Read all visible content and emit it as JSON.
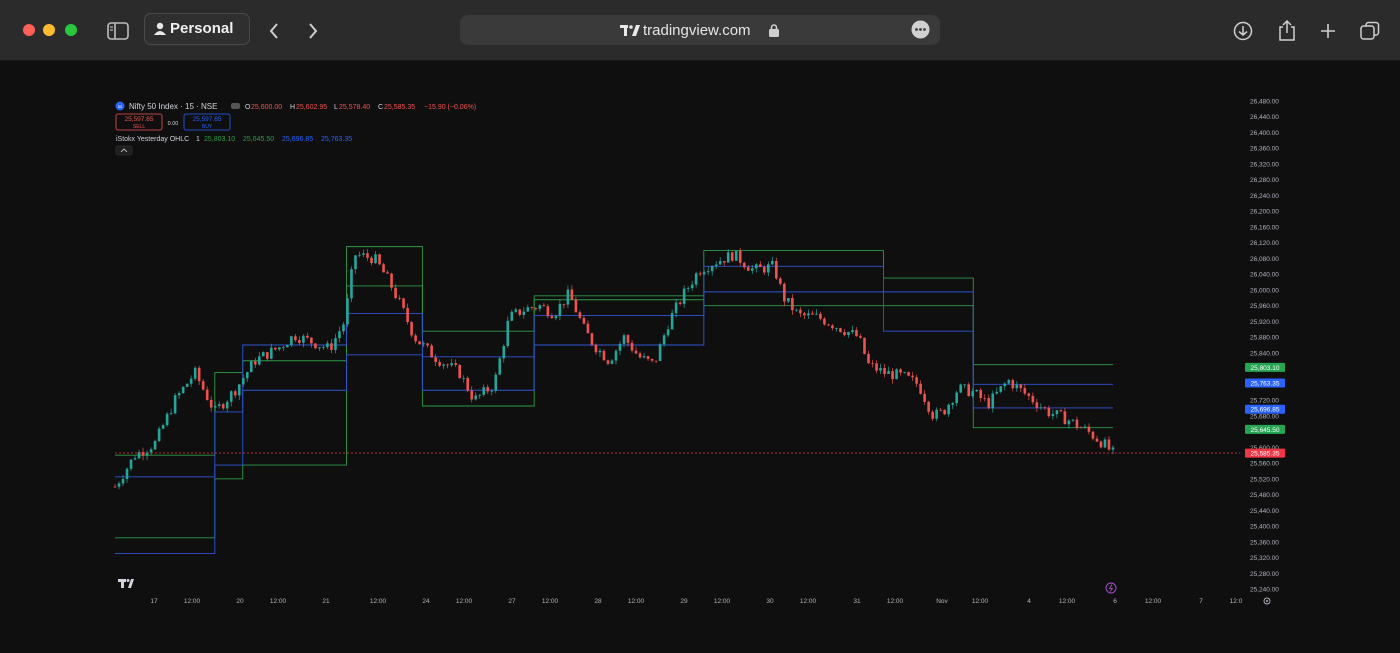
{
  "browser": {
    "profile_label": "Personal",
    "url": "tradingview.com",
    "icons": [
      "sidebar-icon",
      "person-icon",
      "back-icon",
      "forward-icon",
      "tradingview-logo-icon",
      "lock-icon",
      "more-icon",
      "download-icon",
      "share-icon",
      "new-tab-icon",
      "tabs-icon"
    ]
  },
  "legend": {
    "symbol_badge": "50",
    "symbol": "Nifty 50 Index · 15 · NSE",
    "o_label": "O",
    "o_value": "25,600.00",
    "h_label": "H",
    "h_value": "25,602.95",
    "l_label": "L",
    "l_value": "25,578.40",
    "c_label": "C",
    "c_value": "25,585.35",
    "change": "−15.90 (−0.06%)",
    "sell_price": "25,597.65",
    "sell_label": "SELL",
    "spread": "0.00",
    "buy_price": "25,597.65",
    "buy_label": "BUY",
    "indicator_name": "iStokx Yesterday OHLC",
    "indicator_param": "1",
    "ind_v1": "25,803.10",
    "ind_v2": "25,645.50",
    "ind_v3": "25,696.85",
    "ind_v4": "25,763.35",
    "collapse_icon": "chevron-up-icon"
  },
  "chart_data": {
    "type": "candlestick",
    "symbol": "Nifty 50 Index",
    "interval": "15",
    "exchange": "NSE",
    "y_ticks": [
      "26,480.00",
      "26,440.00",
      "26,400.00",
      "26,360.00",
      "26,320.00",
      "26,280.00",
      "26,240.00",
      "26,200.00",
      "26,160.00",
      "26,120.00",
      "26,080.00",
      "26,040.00",
      "26,000.00",
      "25,960.00",
      "25,920.00",
      "25,880.00",
      "25,840.00",
      "25,720.00",
      "25,680.00",
      "25,600.00",
      "25,560.00",
      "25,520.00",
      "25,480.00",
      "25,440.00",
      "25,400.00",
      "25,360.00",
      "25,320.00",
      "25,280.00",
      "25,240.00"
    ],
    "x_ticks": [
      "17",
      "12:00",
      "20",
      "12:00",
      "21",
      "12:00",
      "24",
      "12:00",
      "27",
      "12:00",
      "28",
      "12:00",
      "29",
      "12:00",
      "30",
      "12:00",
      "31",
      "12:00",
      "Nov",
      "12:00",
      "4",
      "12:00",
      "6",
      "12:00",
      "7",
      "12:0"
    ],
    "ylim": [
      25230,
      26480
    ],
    "path_points": [
      [
        0,
        25500
      ],
      [
        20,
        25580
      ],
      [
        40,
        25610
      ],
      [
        60,
        25720
      ],
      [
        80,
        25790
      ],
      [
        100,
        25690
      ],
      [
        120,
        25745
      ],
      [
        140,
        25820
      ],
      [
        165,
        25855
      ],
      [
        180,
        25885
      ],
      [
        200,
        25865
      ],
      [
        215,
        25850
      ],
      [
        230,
        25920
      ],
      [
        240,
        26090
      ],
      [
        260,
        26080
      ],
      [
        275,
        26020
      ],
      [
        290,
        25940
      ],
      [
        300,
        25880
      ],
      [
        320,
        25830
      ],
      [
        345,
        25790
      ],
      [
        360,
        25720
      ],
      [
        380,
        25760
      ],
      [
        395,
        25930
      ],
      [
        410,
        25950
      ],
      [
        425,
        25960
      ],
      [
        440,
        25940
      ],
      [
        455,
        25990
      ],
      [
        470,
        25900
      ],
      [
        480,
        25860
      ],
      [
        495,
        25820
      ],
      [
        510,
        25880
      ],
      [
        525,
        25830
      ],
      [
        540,
        25810
      ],
      [
        555,
        25920
      ],
      [
        570,
        25990
      ],
      [
        585,
        26050
      ],
      [
        600,
        26070
      ],
      [
        620,
        26090
      ],
      [
        640,
        26050
      ],
      [
        660,
        26060
      ],
      [
        670,
        25980
      ],
      [
        685,
        25935
      ],
      [
        705,
        25930
      ],
      [
        725,
        25905
      ],
      [
        745,
        25880
      ],
      [
        755,
        25810
      ],
      [
        770,
        25790
      ],
      [
        790,
        25780
      ],
      [
        805,
        25760
      ],
      [
        820,
        25680
      ],
      [
        830,
        25690
      ],
      [
        845,
        25750
      ],
      [
        860,
        25740
      ],
      [
        875,
        25710
      ],
      [
        895,
        25770
      ],
      [
        915,
        25730
      ],
      [
        935,
        25690
      ],
      [
        955,
        25670
      ],
      [
        975,
        25640
      ],
      [
        995,
        25600
      ],
      [
        998,
        25585
      ]
    ],
    "last_price": "25,585.35",
    "levels": {
      "hl_green": [
        [
          [
            0,
            100
          ],
          25370
        ],
        [
          [
            100,
            128
          ],
          25520
        ],
        [
          [
            128,
            232
          ],
          25555
        ],
        [
          [
            232,
            308
          ],
          26110
        ],
        [
          [
            308,
            420
          ],
          25705
        ],
        [
          [
            420,
            590
          ],
          25985
        ],
        [
          [
            590,
            770
          ],
          26100
        ],
        [
          [
            770,
            860
          ],
          26030
        ],
        [
          [
            860,
            1000
          ],
          25650
        ]
      ],
      "hl_green_hi": [
        [
          [
            0,
            100
          ],
          25580
        ],
        [
          [
            100,
            128
          ],
          25790
        ],
        [
          [
            128,
            232
          ],
          25820
        ],
        [
          [
            232,
            308
          ],
          26010
        ],
        [
          [
            308,
            420
          ],
          25895
        ],
        [
          [
            420,
            590
          ],
          25975
        ],
        [
          [
            590,
            770
          ],
          25960
        ],
        [
          [
            770,
            860
          ],
          25960
        ],
        [
          [
            860,
            1000
          ],
          25810
        ]
      ],
      "blue_a": [
        [
          [
            0,
            100
          ],
          25330
        ],
        [
          [
            100,
            128
          ],
          25690
        ],
        [
          [
            128,
            232
          ],
          25745
        ],
        [
          [
            232,
            308
          ],
          25835
        ],
        [
          [
            308,
            420
          ],
          25830
        ],
        [
          [
            420,
            590
          ],
          25935
        ],
        [
          [
            590,
            770
          ],
          26060
        ],
        [
          [
            770,
            860
          ],
          25995
        ],
        [
          [
            860,
            1000
          ],
          25700
        ]
      ],
      "blue_b": [
        [
          [
            0,
            100
          ],
          25525
        ],
        [
          [
            100,
            128
          ],
          25555
        ],
        [
          [
            128,
            232
          ],
          25860
        ],
        [
          [
            232,
            308
          ],
          25940
        ],
        [
          [
            308,
            420
          ],
          25745
        ],
        [
          [
            420,
            590
          ],
          25860
        ],
        [
          [
            590,
            770
          ],
          25995
        ],
        [
          [
            770,
            860
          ],
          25895
        ],
        [
          [
            860,
            1000
          ],
          25760
        ]
      ]
    },
    "price_labels": [
      {
        "value": "25,803.10",
        "color": "#26a653"
      },
      {
        "value": "25,763.35",
        "color": "#2962ff"
      },
      {
        "value": "25,696.85",
        "color": "#2962ff"
      },
      {
        "value": "25,645.50",
        "color": "#26a653"
      },
      {
        "value": "25,585.35",
        "color": "#f23645"
      }
    ]
  },
  "colors": {
    "up": "#26a69a",
    "down": "#ef5350",
    "green_line": "#2e9b47",
    "blue_line": "#2f55d4",
    "bg": "#0f0f0f"
  }
}
